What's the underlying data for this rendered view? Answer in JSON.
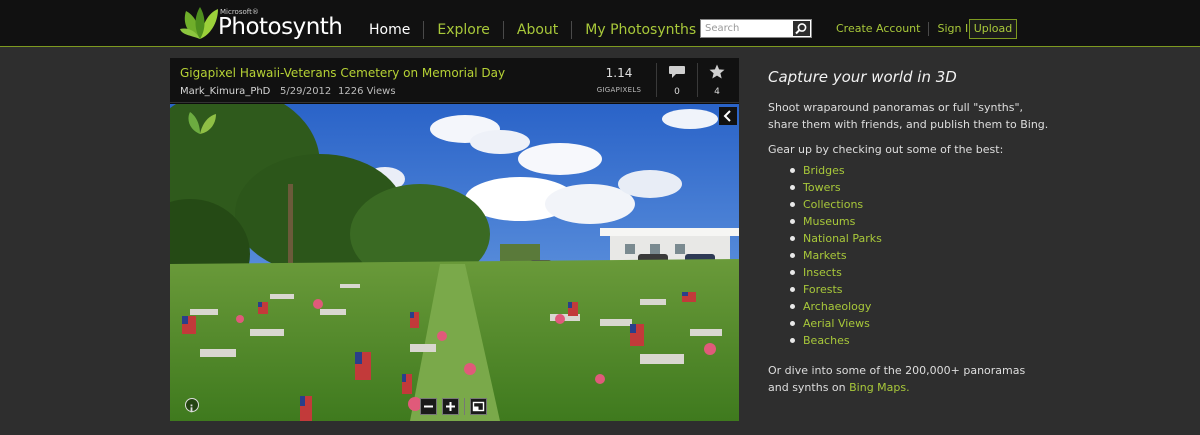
{
  "header": {
    "logo_microsoft": "Microsoft®",
    "logo_name": "Photosynth",
    "nav": [
      "Home",
      "Explore",
      "About",
      "My Photosynths"
    ],
    "search_placeholder": "Search",
    "account_links": [
      "Create Account",
      "Sign In"
    ],
    "upload_label": "Upload"
  },
  "viewer": {
    "title": "Gigapixel Hawaii-Veterans Cemetery on Memorial Day",
    "author": "Mark_Kimura_PhD",
    "date": "5/29/2012",
    "views": "1226 Views",
    "size_value": "1.14",
    "size_unit": "GIGAPIXELS",
    "comments": "0",
    "favorites": "4"
  },
  "sidebar": {
    "tagline": "Capture your world in 3D",
    "intro_line1": "Shoot wraparound panoramas or full \"synths\",",
    "intro_line2": "share them with friends, and publish them to Bing.",
    "gear_up": "Gear up by checking out some of the best:",
    "categories": [
      "Bridges",
      "Towers",
      "Collections",
      "Museums",
      "National Parks",
      "Markets",
      "Insects",
      "Forests",
      "Archaeology",
      "Aerial Views",
      "Beaches"
    ],
    "dive_line1": "Or dive into some of the 200,000+ panoramas",
    "dive_line2_prefix": "and synths on ",
    "bing_maps_link": "Bing Maps."
  },
  "colors": {
    "accent_green": "#a8c83a",
    "header_bg": "#111111",
    "page_bg": "#2e2e2e"
  }
}
